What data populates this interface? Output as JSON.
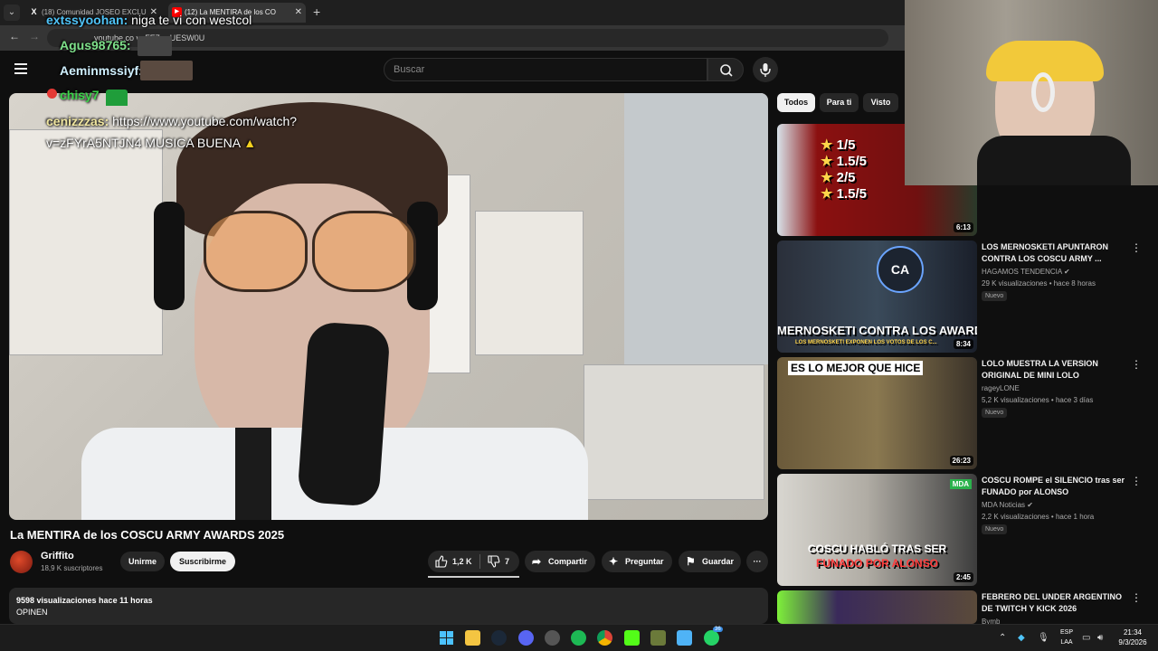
{
  "browser": {
    "tabs": [
      {
        "label": "(18) Comunidad JOSEO EXCLU",
        "favicon": "x-icon",
        "active": false
      },
      {
        "label": "(12) La MENTIRA de los CO",
        "favicon": "youtube-icon",
        "active": true
      }
    ],
    "new_tab_label": "+",
    "url": "youtube.co     v=FE7zwUESW0U"
  },
  "header": {
    "search_placeholder": "Buscar"
  },
  "chat_overlay": [
    {
      "user": "extssyoohan:",
      "message": "niga te vi con westcol",
      "color": "#4fc3f7"
    },
    {
      "user": "Agus98765:",
      "message": "",
      "color": "#7ee08a"
    },
    {
      "user": "Aeminmssiyf:",
      "message": "",
      "color": "#d0f0ff"
    },
    {
      "user": "chisy7",
      "message": "",
      "color": "#3bd44a"
    },
    {
      "user": "cenizzzas:",
      "message": "https://www.youtube.com/watch?",
      "color": "#f0e6a0"
    },
    {
      "user": "",
      "message": "v=zFYrA5NTJN4 MUSICA BUENA",
      "color": "#fff"
    }
  ],
  "video": {
    "title": "La MENTIRA de los COSCU ARMY AWARDS 2025",
    "channel": "Griffito",
    "subscribers": "18,9 K suscriptores",
    "join_label": "Unirme",
    "subscribe_label": "Suscribirme",
    "likes": "1,2 K",
    "dislikes": "7",
    "share_label": "Compartir",
    "ask_label": "Preguntar",
    "save_label": "Guardar",
    "more_label": "···",
    "stats": "9598 visualizaciones  hace 11 horas",
    "description": "OPINEN"
  },
  "filters": [
    "Todos",
    "Para ti",
    "Visto"
  ],
  "recommendations": [
    {
      "duration": "6:13",
      "thumb_text": [
        "1/5",
        "1.5/5",
        "2/5",
        "1.5/5"
      ]
    },
    {
      "title": "LOS MERNOSKETI APUNTARON CONTRA LOS COSCU ARMY ...",
      "channel": "HAGAMOS TENDENCIA",
      "meta": "29 K visualizaciones • hace 8 horas",
      "badge": "Nuevo",
      "duration": "8:34",
      "thumb_text": "MERNOSKETI CONTRA LOS AWARDS",
      "thumb_sub": "LOS MERNOSKETI EXPONEN LOS VOTOS DE LOS C...",
      "thumb_tag": "CA"
    },
    {
      "title": "LOLO MUESTRA LA VERSION ORIGINAL DE MINI LOLO",
      "channel": "rageyLONE",
      "meta": "5,2 K visualizaciones • hace 3 días",
      "badge": "Nuevo",
      "duration": "26:23",
      "thumb_text": "ES LO MEJOR QUE HICE"
    },
    {
      "title": "COSCU ROMPE el SILENCIO tras ser FUNADO por ALONSO",
      "channel": "MDA Noticias",
      "meta": "2,2 K visualizaciones • hace 1 hora",
      "badge": "Nuevo",
      "duration": "2:45",
      "thumb_text": "COSCU HABLÓ TRAS SER",
      "thumb_text2": "FUNADO POR ALONSO",
      "thumb_tag": "MDA"
    },
    {
      "title": "FEBRERO DEL UNDER ARGENTINO DE TWITCH Y KICK 2026",
      "channel": "Bymb"
    }
  ],
  "taskbar": {
    "lang_line1": "ESP",
    "lang_line2": "LAA",
    "time": "21:34",
    "date": "9/3/2026",
    "whatsapp_badge": "36"
  },
  "colors": {
    "background": "#0f0f0f",
    "surface": "#272727",
    "accent_red": "#ff0000"
  }
}
